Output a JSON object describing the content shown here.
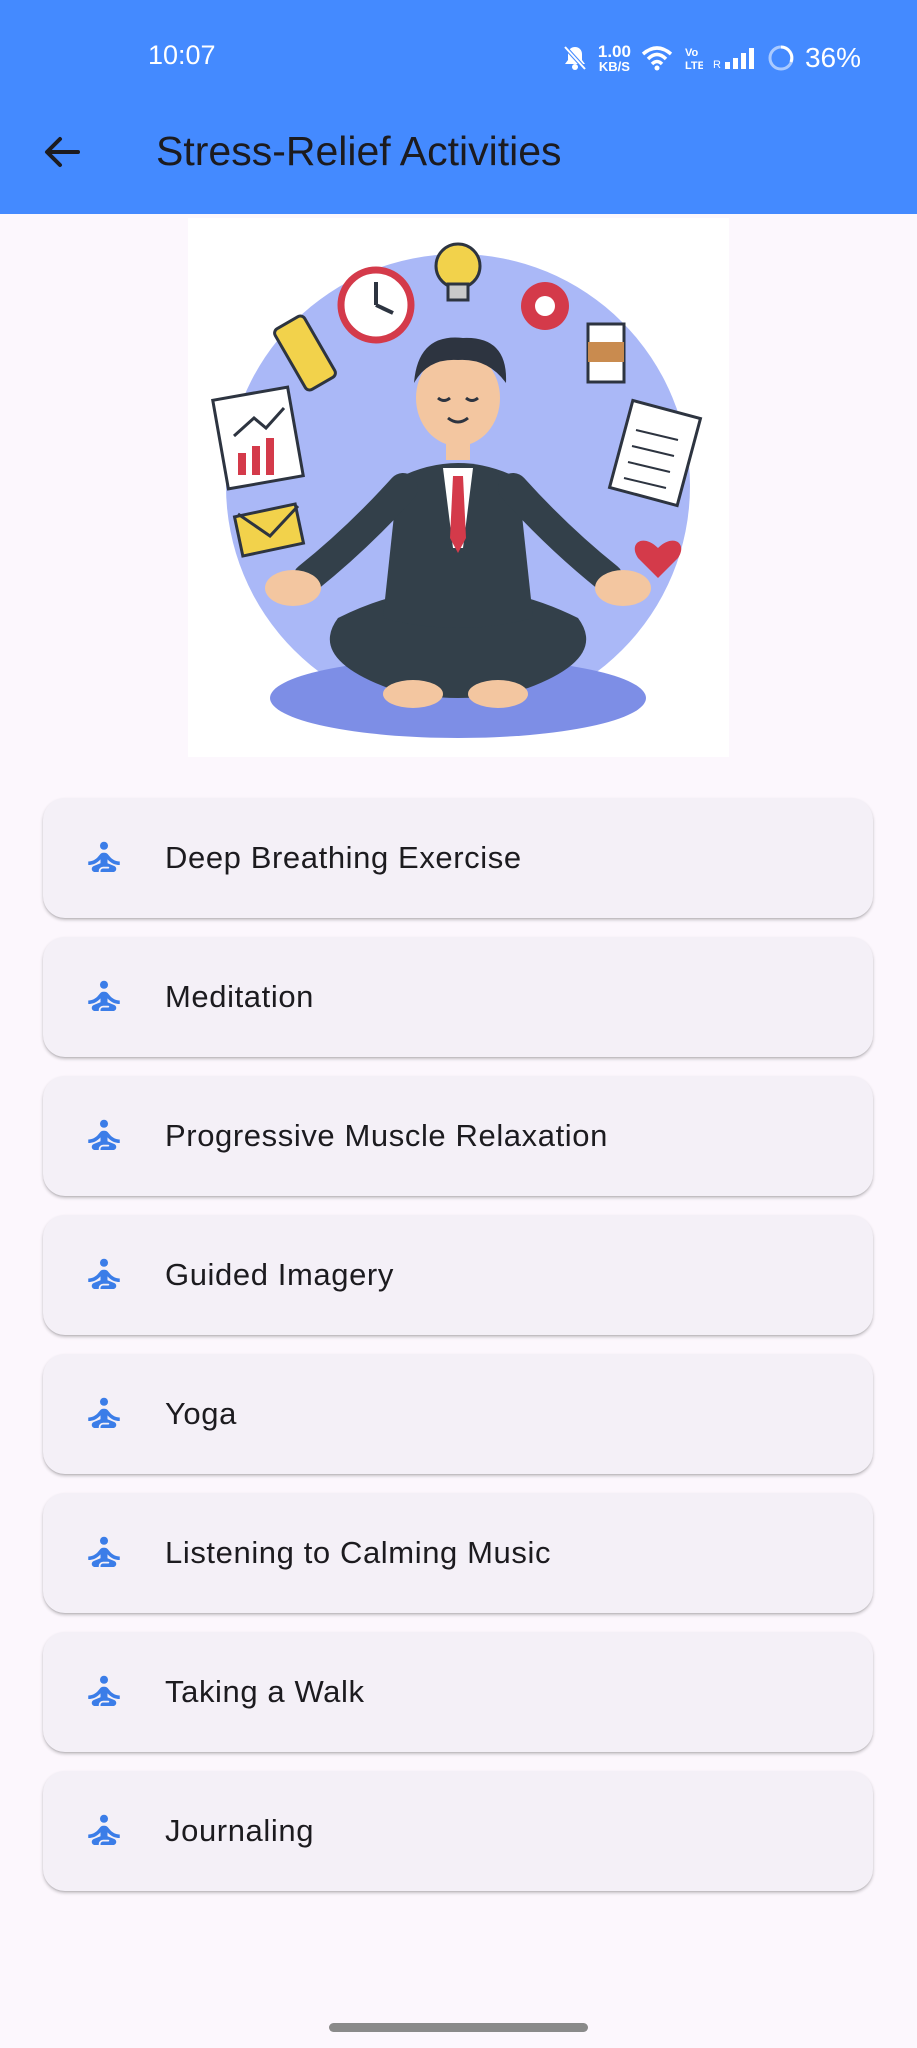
{
  "status_bar": {
    "time": "10:07",
    "speed": "1.00",
    "speed_unit": "KB/S",
    "battery": "36%",
    "icons": [
      "bell-off-icon",
      "wifi-icon",
      "volte-icon",
      "signal-icon",
      "battery-icon"
    ]
  },
  "app_bar": {
    "title": "Stress-Relief Activities",
    "back_icon": "arrow-left-icon",
    "background": "#448aff"
  },
  "hero_image": {
    "description_icon": "meditating-man-illustration"
  },
  "activities": [
    {
      "label": "Deep Breathing Exercise",
      "icon": "self-improvement-icon"
    },
    {
      "label": "Meditation",
      "icon": "self-improvement-icon"
    },
    {
      "label": "Progressive Muscle Relaxation",
      "icon": "self-improvement-icon"
    },
    {
      "label": "Guided Imagery",
      "icon": "self-improvement-icon"
    },
    {
      "label": "Yoga",
      "icon": "self-improvement-icon"
    },
    {
      "label": "Listening to Calming Music",
      "icon": "self-improvement-icon"
    },
    {
      "label": "Taking a Walk",
      "icon": "self-improvement-icon"
    },
    {
      "label": "Journaling",
      "icon": "self-improvement-icon"
    }
  ],
  "colors": {
    "accent": "#448aff",
    "card": "#f4f0f7",
    "background": "#fcf7fd",
    "icon": "#3b7de8"
  }
}
